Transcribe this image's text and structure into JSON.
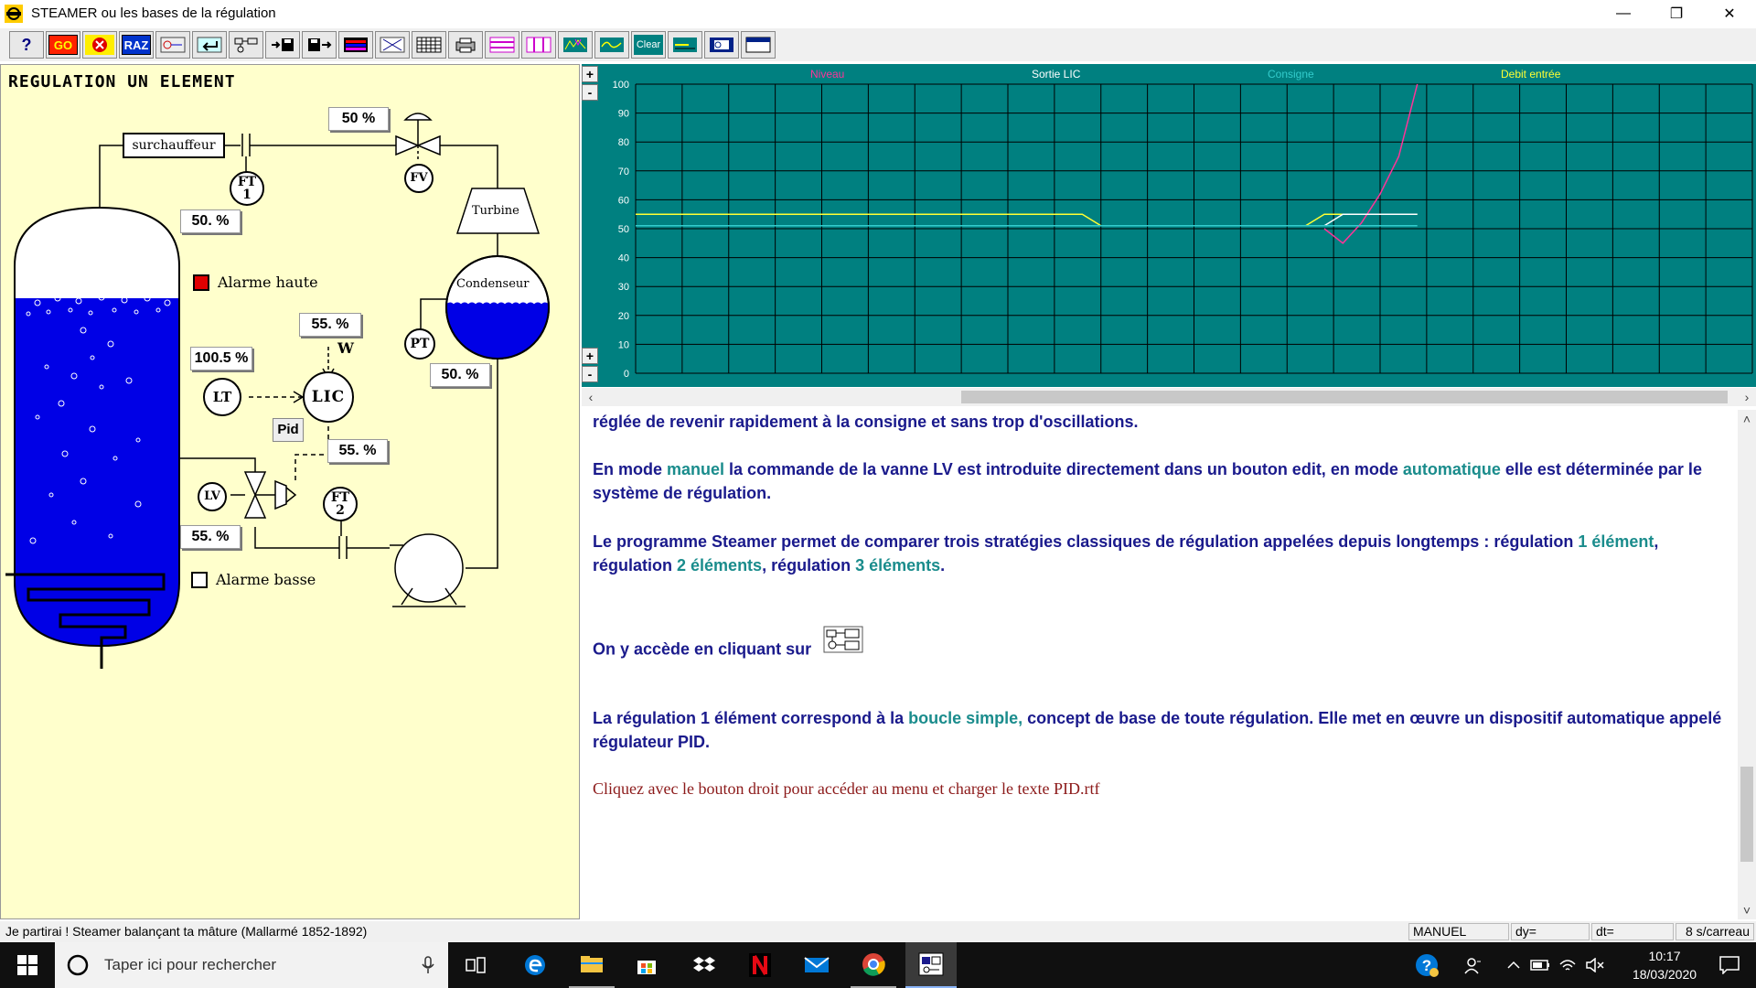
{
  "window": {
    "title": "STEAMER ou les bases de la régulation",
    "controls": [
      "—",
      "❐",
      "✕"
    ]
  },
  "toolbar": {
    "go": "GO",
    "raz": "RAZ",
    "clear": "Clear"
  },
  "diagram": {
    "title": "REGULATION UN ELEMENT",
    "surchauffeur": "surchauffeur",
    "turbine": "Turbine",
    "condenseur": "Condenseur",
    "ft1": "FT",
    "ft1_num": "1",
    "ft2": "FT",
    "ft2_num": "2",
    "fv": "FV",
    "pt": "PT",
    "lt": "LT",
    "lic": "LIC",
    "lv": "LV",
    "w": "W",
    "pid": "Pid",
    "alarme_haute": "Alarme haute",
    "alarme_basse": "Alarme basse",
    "values": {
      "valve_fv": "50 %",
      "ft1": "50. %",
      "consigne": "55. %",
      "lt": "100.5 %",
      "condenseur": "50. %",
      "ft2": "55. %",
      "lv": "55. %"
    },
    "colors": {
      "water": "#0000e6",
      "alarm_high": "#e00000"
    }
  },
  "chart": {
    "legend": [
      {
        "label": "Niveau",
        "color": "#ff3399"
      },
      {
        "label": "Sortie LIC",
        "color": "#ffffff"
      },
      {
        "label": "Consigne",
        "color": "#33cccc"
      },
      {
        "label": "Debit entrée",
        "color": "#ffff33"
      }
    ],
    "yticks": [
      "100",
      "90",
      "80",
      "70",
      "60",
      "50",
      "40",
      "30",
      "20",
      "10",
      "0"
    ],
    "zoom_plus": "+",
    "zoom_minus": "-"
  },
  "chart_data": {
    "type": "line",
    "ylim": [
      0,
      100
    ],
    "x": [
      0,
      0.5,
      1,
      1.5,
      2,
      2.5,
      3,
      3.5,
      4,
      4.5,
      5,
      5.5,
      6,
      6.5,
      7,
      7.5,
      8,
      8.5,
      9,
      9.5,
      10,
      10.5,
      11,
      11.5,
      12,
      12.5,
      13,
      13.5,
      14,
      14.5,
      15,
      15.5,
      16,
      16.5,
      17,
      17.5,
      18,
      18.5,
      19,
      19.5,
      20,
      20.5,
      21
    ],
    "series": [
      {
        "name": "Debit entrée",
        "values": [
          55,
          55,
          55,
          55,
          55,
          55,
          55,
          55,
          55,
          55,
          55,
          55,
          55,
          55,
          55,
          55,
          55,
          55,
          55,
          55,
          55,
          55,
          55,
          55,
          55,
          51,
          51,
          51,
          51,
          51,
          51,
          51,
          51,
          51,
          51,
          51,
          51,
          55,
          55,
          55,
          55,
          55,
          55
        ]
      },
      {
        "name": "Niveau",
        "values": [
          null,
          null,
          null,
          null,
          null,
          null,
          null,
          null,
          null,
          null,
          null,
          null,
          null,
          null,
          null,
          null,
          null,
          null,
          null,
          null,
          null,
          null,
          null,
          null,
          null,
          null,
          null,
          null,
          null,
          null,
          null,
          null,
          null,
          null,
          null,
          null,
          null,
          50,
          45,
          52,
          62,
          75,
          100
        ]
      },
      {
        "name": "Sortie LIC",
        "values": [
          null,
          null,
          null,
          null,
          null,
          null,
          null,
          null,
          null,
          null,
          null,
          null,
          null,
          null,
          null,
          null,
          null,
          null,
          null,
          null,
          null,
          null,
          null,
          null,
          null,
          null,
          null,
          null,
          null,
          null,
          null,
          null,
          null,
          null,
          null,
          null,
          null,
          51,
          55,
          55,
          55,
          55,
          55
        ]
      },
      {
        "name": "Consigne",
        "values": [
          51,
          51,
          51,
          51,
          51,
          51,
          51,
          51,
          51,
          51,
          51,
          51,
          51,
          51,
          51,
          51,
          51,
          51,
          51,
          51,
          51,
          51,
          51,
          51,
          51,
          51,
          51,
          51,
          51,
          51,
          51,
          51,
          51,
          51,
          51,
          51,
          51,
          51,
          51,
          51,
          51,
          51,
          51
        ]
      }
    ]
  },
  "text": {
    "p1": "réglée de revenir rapidement à la consigne et sans trop d'oscillations.",
    "p2a": "En mode ",
    "p2b": "manuel",
    "p2c": " la commande de la vanne LV est introduite directement dans un bouton edit, en mode ",
    "p2d": "automatique",
    "p2e": " elle est déterminée par le système de régulation.",
    "p3a": "Le programme Steamer permet de comparer trois stratégies classiques de régulation appelées depuis longtemps : régulation ",
    "p3b": "1 élément",
    "p3c": ", régulation ",
    "p3d": "2 éléments",
    "p3e": ", régulation ",
    "p3f": "3 éléments",
    "p3g": ".",
    "p4": "On y accède en cliquant sur",
    "p5a": "La régulation 1 élément correspond à la ",
    "p5b": "boucle simple,",
    "p5c": " concept de base de toute régulation. Elle met en œuvre un dispositif automatique appelé régulateur PID.",
    "p6": "Cliquez avec le bouton droit pour accéder au menu et charger le texte PID.rtf"
  },
  "status": {
    "quote": "Je partirai ! Steamer balançant ta mâture   (Mallarmé 1852-1892)",
    "mode": "MANUEL",
    "dy": "dy=",
    "dt": "dt=",
    "scale": "8 s/carreau"
  },
  "taskbar": {
    "search_placeholder": "Taper ici pour rechercher",
    "time": "10:17",
    "date": "18/03/2020"
  }
}
